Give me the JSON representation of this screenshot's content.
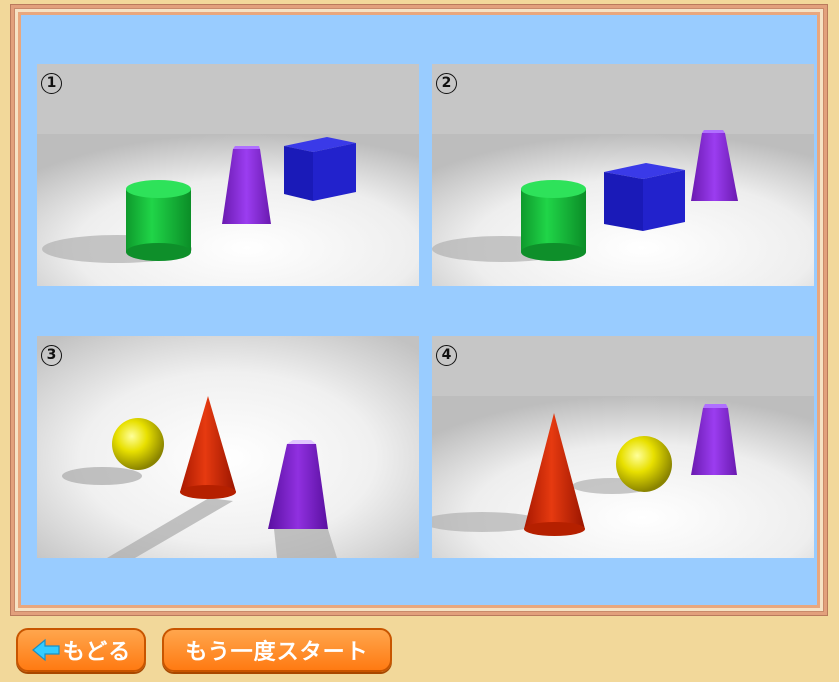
{
  "options": [
    {
      "number": "1",
      "shapes": [
        "cylinder",
        "trapezoid-prism",
        "cube"
      ]
    },
    {
      "number": "2",
      "shapes": [
        "cylinder",
        "cube",
        "trapezoid-prism"
      ]
    },
    {
      "number": "3",
      "shapes": [
        "sphere",
        "cone",
        "trapezoid-prism"
      ]
    },
    {
      "number": "4",
      "shapes": [
        "cone",
        "sphere",
        "trapezoid-prism"
      ]
    }
  ],
  "buttons": {
    "back_label": "もどる",
    "restart_label": "もう一度スタート"
  },
  "icons": {
    "back": "left-arrow-icon"
  },
  "colors": {
    "background": "#f2d89a",
    "stage": "#99ccff",
    "button": "#ff8a2a",
    "arrow": "#33ccff"
  }
}
